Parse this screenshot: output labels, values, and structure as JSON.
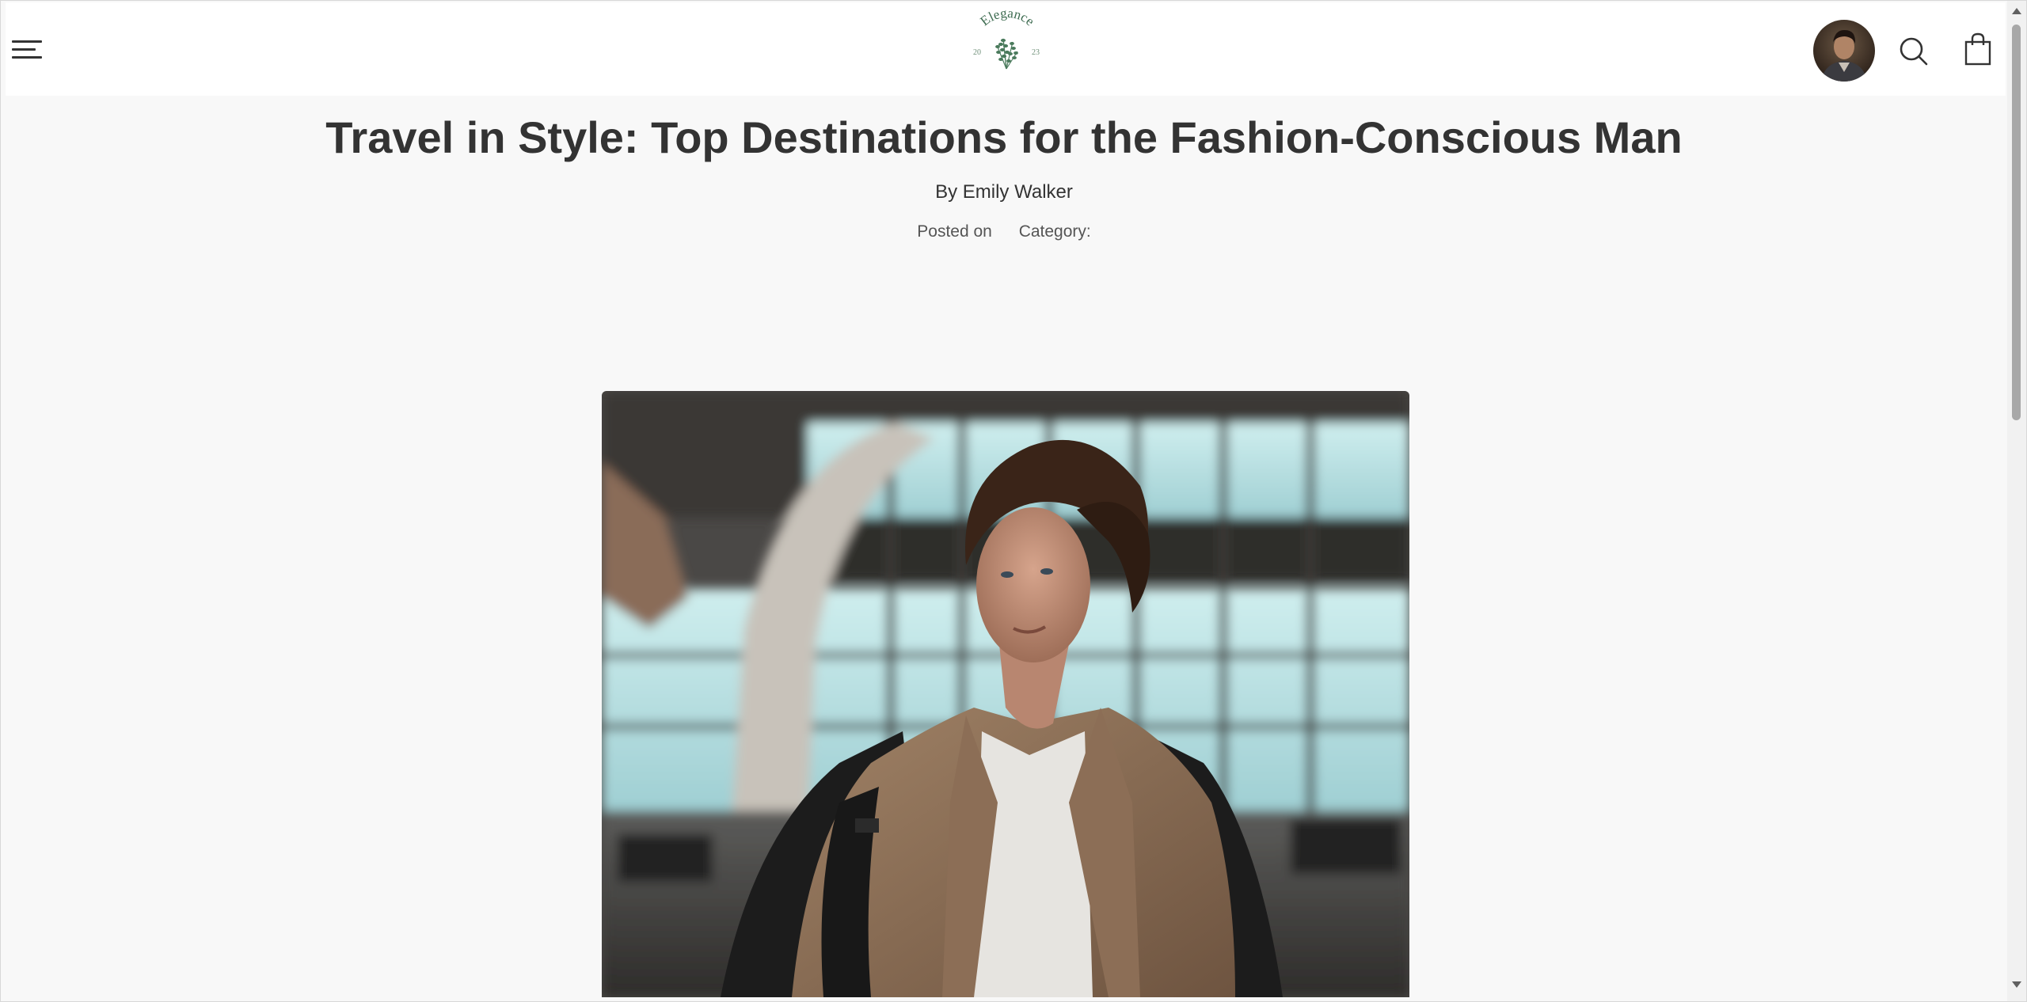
{
  "header": {
    "logo": {
      "brand": "Elegance",
      "year_left": "20",
      "year_right": "23"
    },
    "icons": {
      "menu": "hamburger-menu-icon",
      "avatar": "user-avatar",
      "search": "search-icon",
      "cart": "shopping-bag-icon"
    }
  },
  "article": {
    "title": "Travel in Style: Top Destinations for the Fashion-Conscious Man",
    "author": "By Emily Walker",
    "posted_label": "Posted on",
    "category_label": "Category:",
    "hero_image": "man-in-airport-terminal-photo"
  },
  "colors": {
    "background": "#f8f8f8",
    "header": "#ffffff",
    "text": "#333333",
    "logo_green": "#4a7a5c"
  }
}
